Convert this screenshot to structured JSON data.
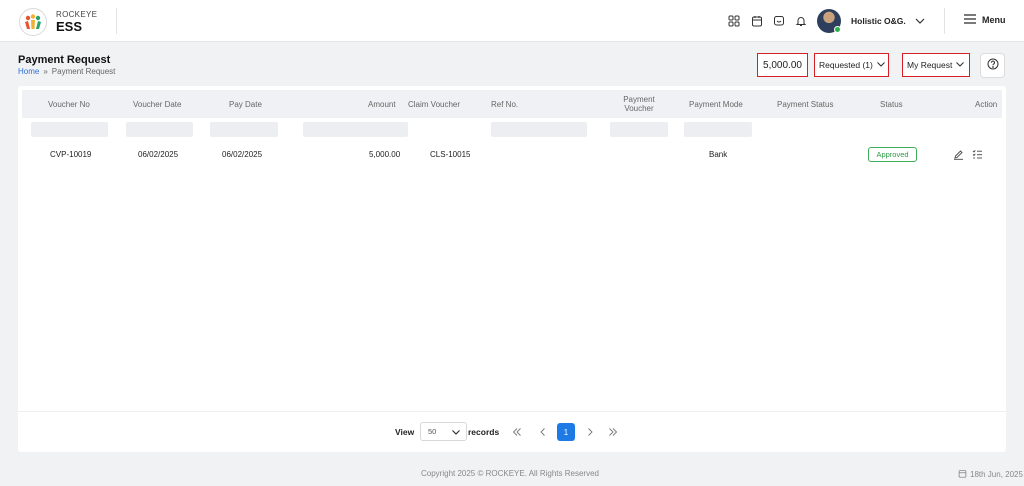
{
  "brand": {
    "top": "ROCKEYE",
    "main": "ESS"
  },
  "header": {
    "user_name": "Holistic O&G.",
    "menu_label": "Menu"
  },
  "page": {
    "title": "Payment Request",
    "breadcrumb": [
      "Home",
      "»",
      "Payment Request"
    ],
    "total_amount": "5,000.00",
    "status_filter": "Requested (1)",
    "scope_filter": "My Request"
  },
  "table": {
    "columns": [
      "Voucher No",
      "Voucher Date",
      "Pay Date",
      "Amount",
      "Claim Voucher",
      "Ref No.",
      "Payment Voucher",
      "Payment Mode",
      "Payment Status",
      "Status",
      "Action"
    ],
    "rows": [
      {
        "voucher_no": "CVP-10019",
        "voucher_date": "06/02/2025",
        "pay_date": "06/02/2025",
        "amount": "5,000.00",
        "claim_voucher": "CLS-10015",
        "ref_no": "",
        "payment_voucher": "",
        "payment_mode": "Bank",
        "payment_status": "",
        "status": "Approved"
      }
    ]
  },
  "pagination": {
    "view_label": "View",
    "page_size": "50",
    "records_label": "records",
    "current_page": "1"
  },
  "footer": {
    "copyright": "Copyright 2025 © ROCKEYE. All Rights Reserved",
    "date": "18th Jun, 2025"
  },
  "colors": {
    "accent": "#1e7be6",
    "highlight": "#d71f26",
    "approved": "#2e9b47"
  },
  "icons": [
    "apps-icon",
    "calendar-icon",
    "chat-icon",
    "bell-icon",
    "chevron-down-icon",
    "hamburger-icon",
    "help-icon",
    "edit-icon",
    "list-icon",
    "first-page-icon",
    "prev-page-icon",
    "next-page-icon",
    "last-page-icon"
  ]
}
